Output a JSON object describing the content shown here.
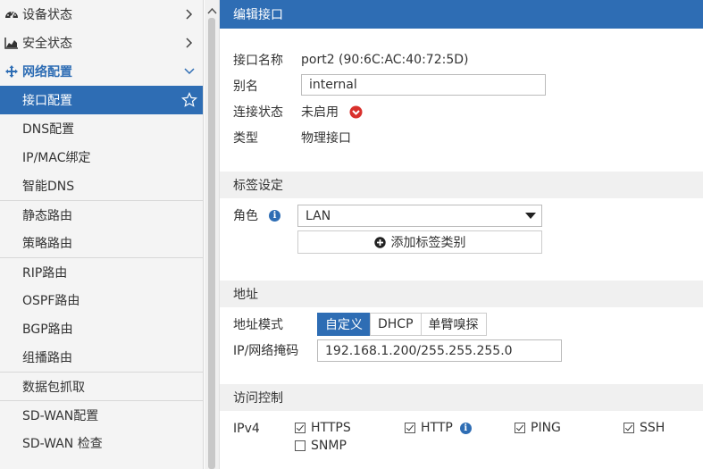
{
  "sidebar": {
    "categories": [
      {
        "label": "设备状态",
        "icon": "dashboard-icon"
      },
      {
        "label": "安全状态",
        "icon": "chart-icon"
      },
      {
        "label": "网络配置",
        "icon": "move-icon"
      }
    ],
    "items": [
      {
        "label": "接口配置"
      },
      {
        "label": "DNS配置"
      },
      {
        "label": "IP/MAC绑定"
      },
      {
        "label": "智能DNS"
      },
      {
        "label": "静态路由"
      },
      {
        "label": "策略路由"
      },
      {
        "label": "RIP路由"
      },
      {
        "label": "OSPF路由"
      },
      {
        "label": "BGP路由"
      },
      {
        "label": "组播路由"
      },
      {
        "label": "数据包抓取"
      },
      {
        "label": "SD-WAN配置"
      },
      {
        "label": "SD-WAN 检查"
      }
    ]
  },
  "main": {
    "title": "编辑接口",
    "interface": {
      "name_label": "接口名称",
      "name_value": "port2 (90:6C:AC:40:72:5D)",
      "alias_label": "别名",
      "alias_value": "internal",
      "status_label": "连接状态",
      "status_value": "未启用",
      "type_label": "类型",
      "type_value": "物理接口"
    },
    "tags": {
      "section": "标签设定",
      "role_label": "角色",
      "role_value": "LAN",
      "add_button": "添加标签类别"
    },
    "address": {
      "section": "地址",
      "mode_label": "地址模式",
      "modes": [
        "自定义",
        "DHCP",
        "单臂嗅探"
      ],
      "ip_label": "IP/网络掩码",
      "ip_value": "192.168.1.200/255.255.255.0"
    },
    "access": {
      "section": "访问控制",
      "ipv4_label": "IPv4",
      "options": [
        {
          "label": "HTTPS",
          "checked": true
        },
        {
          "label": "HTTP",
          "checked": true
        },
        {
          "label": "PING",
          "checked": true
        },
        {
          "label": "SSH",
          "checked": true
        },
        {
          "label": "SNMP",
          "checked": false
        }
      ]
    }
  },
  "colors": {
    "accent": "#2e6db4",
    "status_down": "#d9302c"
  }
}
